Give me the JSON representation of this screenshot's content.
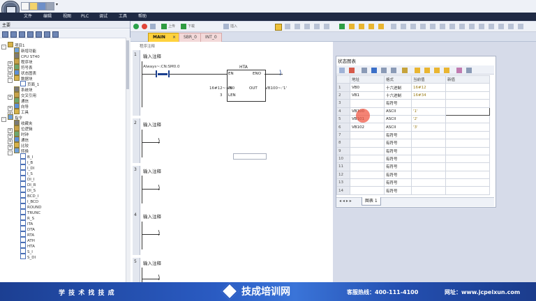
{
  "app": {
    "title_mark": "▾"
  },
  "menu": [
    "文件",
    "编辑",
    "视图",
    "PLC",
    "调试",
    "工具",
    "帮助"
  ],
  "left_panel": {
    "header": "主要",
    "tree": [
      {
        "label": "项目1",
        "depth": 0,
        "exp": "-"
      },
      {
        "label": "新增功能",
        "depth": 1,
        "exp": ""
      },
      {
        "label": "CPU ST40",
        "depth": 1,
        "exp": ""
      },
      {
        "label": "程序块",
        "depth": 1,
        "exp": "+"
      },
      {
        "label": "符号表",
        "depth": 1,
        "exp": "+"
      },
      {
        "label": "状态图表",
        "depth": 1,
        "exp": "+"
      },
      {
        "label": "数据块",
        "depth": 1,
        "exp": "-"
      },
      {
        "label": "页面_1",
        "depth": 2,
        "exp": ""
      },
      {
        "label": "系统块",
        "depth": 1,
        "exp": ""
      },
      {
        "label": "交叉引用",
        "depth": 1,
        "exp": "+"
      },
      {
        "label": "通信",
        "depth": 1,
        "exp": ""
      },
      {
        "label": "向导",
        "depth": 1,
        "exp": "+"
      },
      {
        "label": "工具",
        "depth": 1,
        "exp": "+"
      },
      {
        "label": "指令",
        "depth": 0,
        "exp": "-"
      },
      {
        "label": "收藏夹",
        "depth": 1,
        "exp": ""
      },
      {
        "label": "位逻辑",
        "depth": 1,
        "exp": "+"
      },
      {
        "label": "时钟",
        "depth": 1,
        "exp": "+"
      },
      {
        "label": "通信",
        "depth": 1,
        "exp": "+"
      },
      {
        "label": "比较",
        "depth": 1,
        "exp": "+"
      },
      {
        "label": "转换",
        "depth": 1,
        "exp": "-"
      },
      {
        "label": "B_I",
        "depth": 2,
        "exp": ""
      },
      {
        "label": "I_B",
        "depth": 2,
        "exp": ""
      },
      {
        "label": "I_DI",
        "depth": 2,
        "exp": ""
      },
      {
        "label": "I_S",
        "depth": 2,
        "exp": ""
      },
      {
        "label": "DI_I",
        "depth": 2,
        "exp": ""
      },
      {
        "label": "DI_R",
        "depth": 2,
        "exp": ""
      },
      {
        "label": "DI_S",
        "depth": 2,
        "exp": ""
      },
      {
        "label": "BCD_I",
        "depth": 2,
        "exp": ""
      },
      {
        "label": "I_BCD",
        "depth": 2,
        "exp": ""
      },
      {
        "label": "ROUND",
        "depth": 2,
        "exp": ""
      },
      {
        "label": "TRUNC",
        "depth": 2,
        "exp": ""
      },
      {
        "label": "R_S",
        "depth": 2,
        "exp": ""
      },
      {
        "label": "ITA",
        "depth": 2,
        "exp": ""
      },
      {
        "label": "DTA",
        "depth": 2,
        "exp": ""
      },
      {
        "label": "RTA",
        "depth": 2,
        "exp": ""
      },
      {
        "label": "ATH",
        "depth": 2,
        "exp": ""
      },
      {
        "label": "HTA",
        "depth": 2,
        "exp": ""
      },
      {
        "label": "S_I",
        "depth": 2,
        "exp": ""
      },
      {
        "label": "S_DI",
        "depth": 2,
        "exp": ""
      }
    ]
  },
  "toolbar": {
    "upload": "上传",
    "download": "下载",
    "insert": "插入"
  },
  "tabs": [
    {
      "label": "MAIN",
      "active": true,
      "close": "×"
    },
    {
      "label": "SBR_0",
      "active": false
    },
    {
      "label": "INT_0",
      "active": false
    }
  ],
  "editor": {
    "note": "程序注释",
    "networks": [
      {
        "num": "1",
        "title": "输入注释"
      },
      {
        "num": "2",
        "title": "输入注释"
      },
      {
        "num": "3",
        "title": "输入注释"
      },
      {
        "num": "4",
        "title": "输入注释"
      },
      {
        "num": "5",
        "title": "输入注释"
      }
    ],
    "contact_label": "Always~:CN:SM0.0",
    "block": {
      "name": "HTA",
      "en": "EN",
      "eno": "ENO",
      "in": "IN",
      "len": "LEN",
      "out": "OUT"
    },
    "operands": {
      "in": "16#12~:VB0",
      "len": "3",
      "out": "VB100~:'1'"
    }
  },
  "status_chart": {
    "title": "状态图表",
    "headers": [
      "",
      "地址",
      "格式",
      "当前值",
      "新值"
    ],
    "rows": [
      [
        "1",
        "VB0",
        "十六进制",
        "16#12",
        ""
      ],
      [
        "2",
        "VB1",
        "十六进制",
        "16#34",
        ""
      ],
      [
        "3",
        "",
        "有符号",
        "",
        ""
      ],
      [
        "4",
        "VB100",
        "ASCII",
        "'1'",
        ""
      ],
      [
        "5",
        "VB101",
        "ASCII",
        "'2'",
        ""
      ],
      [
        "6",
        "VB102",
        "ASCII",
        "'3'",
        ""
      ],
      [
        "7",
        "",
        "有符号",
        "",
        ""
      ],
      [
        "8",
        "",
        "有符号",
        "",
        ""
      ],
      [
        "9",
        "",
        "有符号",
        "",
        ""
      ],
      [
        "10",
        "",
        "有符号",
        "",
        ""
      ],
      [
        "11",
        "",
        "有符号",
        "",
        ""
      ],
      [
        "12",
        "",
        "有符号",
        "",
        ""
      ],
      [
        "13",
        "",
        "有符号",
        "",
        ""
      ],
      [
        "14",
        "",
        "有符号",
        "",
        ""
      ]
    ],
    "sheet_tab": "图表 1",
    "nav": "◂ ◂ ▸ ▸"
  },
  "footer": {
    "slogan": "学 技 术    找 技 成",
    "brand": "技成培训网",
    "hotline": "客服热线：400-111-4100",
    "website": "网址：www.jcpeixun.com"
  }
}
